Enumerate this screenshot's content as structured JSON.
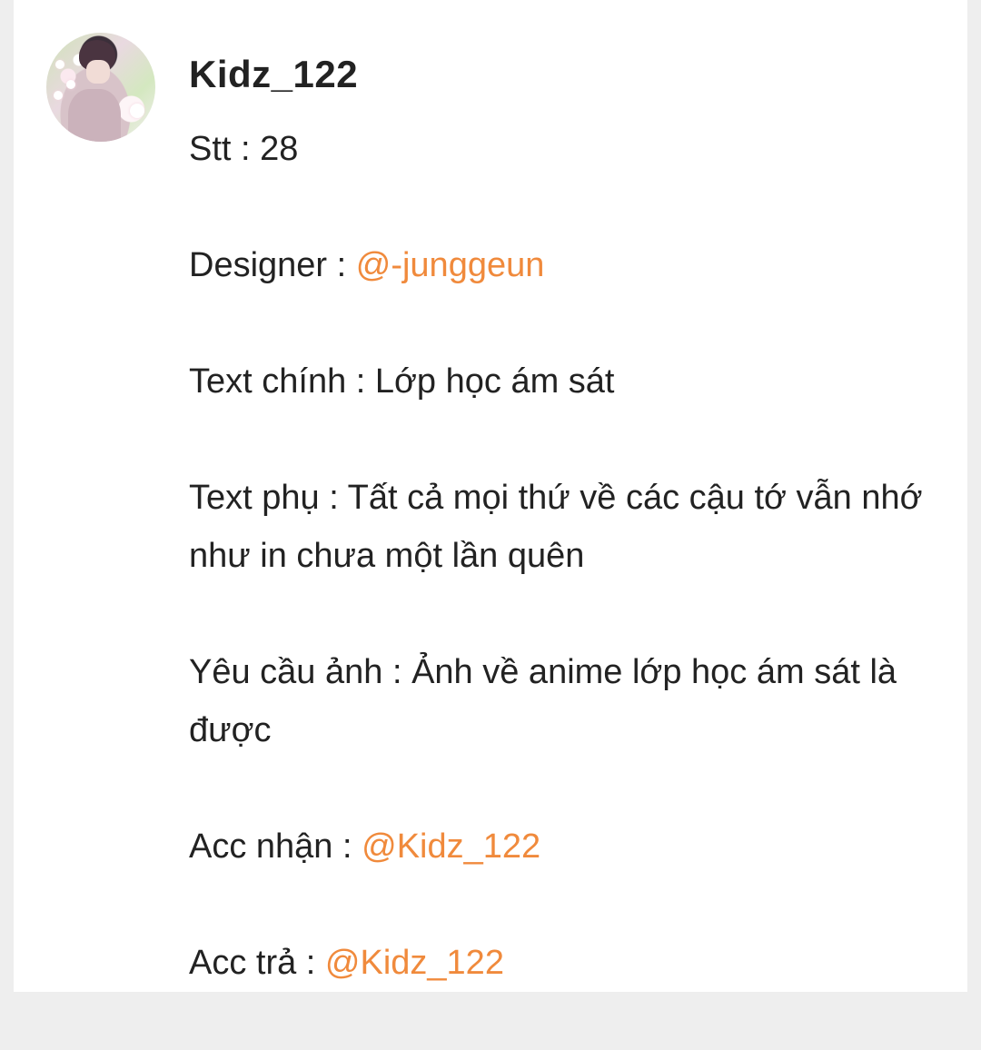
{
  "post": {
    "username": "Kidz_122",
    "avatar_icon": "user-avatar-photo",
    "lines": {
      "stt": "Stt : 28",
      "designer_label": "Designer : ",
      "designer_mention": "@-junggeun",
      "text_chinh": "Text chính : Lớp học ám sát",
      "text_phu": "Text phụ : Tất cả mọi thứ về các cậu tớ vẫn nhớ như in chưa một lần quên",
      "yeu_cau_anh": "Yêu cầu ảnh : Ảnh về anime lớp học ám sát là được",
      "acc_nhan_label": "Acc nhận : ",
      "acc_nhan_mention": "@Kidz_122",
      "acc_tra_label": "Acc trả : ",
      "acc_tra_mention": "@Kidz_122"
    }
  },
  "colors": {
    "mention": "#f08a3c",
    "text": "#222222",
    "card": "#ffffff",
    "background": "#eeeeee"
  }
}
